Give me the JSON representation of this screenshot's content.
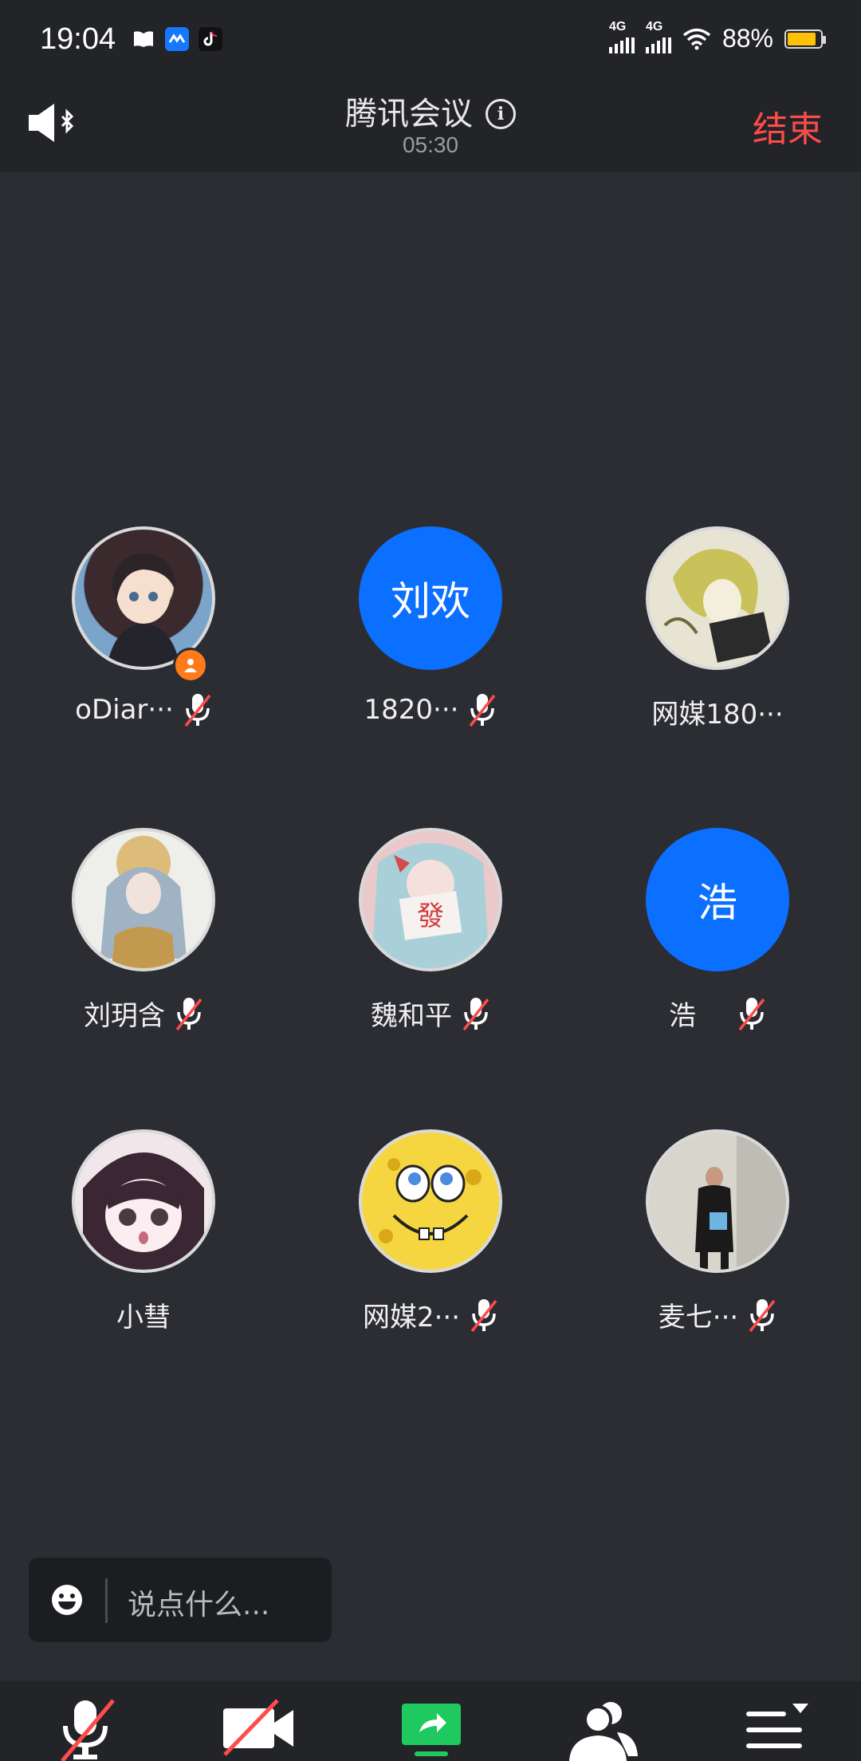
{
  "status_bar": {
    "time": "19:04",
    "notification_icons": [
      "book-icon",
      "message-app-icon",
      "tiktok-icon"
    ],
    "signal_1": "4G",
    "signal_2": "4G",
    "battery_percent": "88%",
    "battery_level": 0.88
  },
  "header": {
    "title": "腾讯会议",
    "info_icon": "info-icon",
    "duration": "05:30",
    "end_button": "结束",
    "speaker_icon": "bluetooth-speaker-icon"
  },
  "participants": [
    {
      "name": "oDiar···",
      "avatar_type": "image",
      "muted": true,
      "host": true
    },
    {
      "name": "1820···",
      "avatar_type": "initials",
      "initials": "刘欢",
      "muted": true,
      "host": false
    },
    {
      "name": "网媒180···",
      "avatar_type": "image",
      "muted": false,
      "host": false
    },
    {
      "name": "刘玥含",
      "avatar_type": "image",
      "muted": true,
      "host": false
    },
    {
      "name": "魏和平",
      "avatar_type": "image",
      "muted": true,
      "host": false
    },
    {
      "name": "浩",
      "avatar_type": "initials",
      "initials": "浩",
      "muted": true,
      "host": false
    },
    {
      "name": "小彗",
      "avatar_type": "image",
      "muted": false,
      "host": false
    },
    {
      "name": "网媒2···",
      "avatar_type": "image",
      "muted": true,
      "host": false
    },
    {
      "name": "麦七···",
      "avatar_type": "image",
      "muted": true,
      "host": false
    }
  ],
  "chat": {
    "placeholder": "说点什么...",
    "emoji_icon": "emoji-icon"
  },
  "toolbar": {
    "items": [
      "mic-muted-icon",
      "camera-off-icon",
      "share-screen-icon",
      "participants-icon",
      "more-menu-icon"
    ]
  },
  "colors": {
    "background": "#2b2d33",
    "bar": "#232428",
    "accent_blue": "#0b6fff",
    "end_red": "#ff4b4b",
    "share_green": "#1ec95f",
    "host_orange": "#ff7a1a"
  }
}
